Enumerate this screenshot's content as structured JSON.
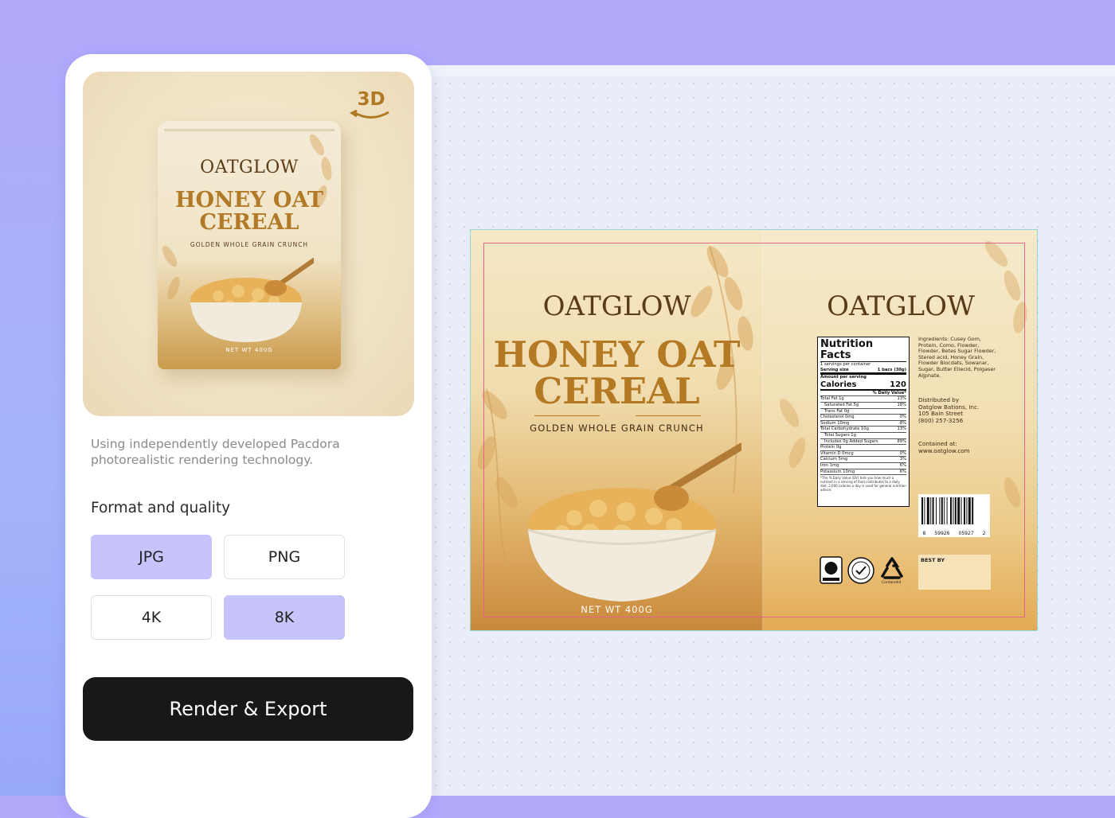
{
  "panel": {
    "preview": {
      "badge": "3D",
      "pouch": {
        "brand": "OATGLOW",
        "title_line1": "HONEY OAT",
        "title_line2": "CEREAL",
        "subtitle": "GOLDEN WHOLE GRAIN CRUNCH",
        "net_weight": "NET WT 400G"
      }
    },
    "description": "Using independently developed Pacdora photorealistic rendering technology.",
    "format_label": "Format and quality",
    "options": [
      {
        "label": "JPG",
        "selected": true
      },
      {
        "label": "PNG",
        "selected": false
      },
      {
        "label": "4K",
        "selected": false
      },
      {
        "label": "8K",
        "selected": true
      }
    ],
    "export_button": "Render & Export"
  },
  "dieline": {
    "front": {
      "brand": "OATGLOW",
      "title_line1": "HONEY OAT",
      "title_line2": "CEREAL",
      "subtitle": "GOLDEN WHOLE GRAIN CRUNCH",
      "net_weight": "NET WT 400G"
    },
    "back": {
      "brand": "OATGLOW",
      "nutrition": {
        "title": "Nutrition Facts",
        "servings": "1 servings per container",
        "serving_size_label": "Serving size",
        "serving_size_value": "1 bacs (30g)",
        "amount_label": "Amount per serving",
        "calories_label": "Calories",
        "calories_value": "120",
        "daily_value_header": "% Daily Value*",
        "rows": [
          {
            "label": "Total Fat 1g",
            "value": "13%"
          },
          {
            "label": "Saturated Fat 5g",
            "value": "18%"
          },
          {
            "label": "Trans Fat 0g",
            "value": ""
          },
          {
            "label": "Cholesterol 0mg",
            "value": "0%"
          },
          {
            "label": "Sodium 10mg",
            "value": "8%"
          },
          {
            "label": "Total Carbohydrate 10g",
            "value": "13%"
          },
          {
            "label": "Total Sugars 1g",
            "value": ""
          },
          {
            "label": "Includes 0g Added Sugars",
            "value": "89%"
          },
          {
            "label": "Protein 0g",
            "value": ""
          },
          {
            "label": "Vitamin D 0mcg",
            "value": "0%"
          },
          {
            "label": "Calcium 5mg",
            "value": "3%"
          },
          {
            "label": "Iron 1mg",
            "value": "6%"
          },
          {
            "label": "Potassium 10mg",
            "value": "6%"
          }
        ],
        "footnote": "*The % Daily Value (DV) tells you how much a nutrient in a serving of food contributes to a daily diet. 2,000 calories a day is used for general nutrition advice."
      },
      "ingredients": "Ingredients: Cusey Gom, Protein, Como, Flowder, Flowder, Betes Sugar Flowder, Stered acid, Honey Grain, Flowder Biocdats, Sowanar, Sugar, Butter Eliecid, Polgaser Aljphate.",
      "distributed_lines": [
        "Distributed by",
        "Oatglow Bations, Inc.",
        "105 Bain Street",
        "(800) 257-3256"
      ],
      "contained_lines": [
        "Contained at:",
        "www.oatglow.com"
      ],
      "barcode_digits": [
        "8",
        "59926",
        "05927",
        "2"
      ],
      "best_by": "BEST BY",
      "icon_names": [
        "certification-icon",
        "quality-seal-icon",
        "recycle-icon"
      ],
      "icon_labels": [
        "Containdid"
      ]
    }
  },
  "colors": {
    "accent": "#c7c3fb",
    "button": "#181818",
    "gold": "#b47923",
    "brown": "#5a3b17"
  }
}
